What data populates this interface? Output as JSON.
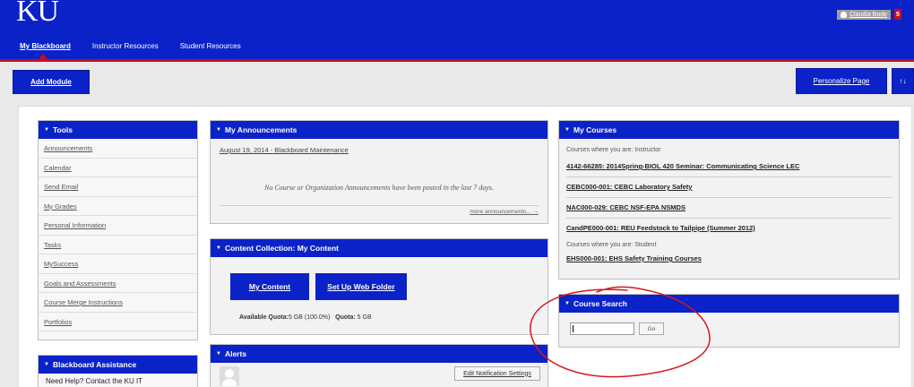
{
  "header": {
    "logo": "KU",
    "nav": [
      "My Blackboard",
      "Instructor Resources",
      "Student Resources"
    ],
    "user_name": "Claudia Bode",
    "user_badge": "5"
  },
  "toolbar": {
    "add_module": "Add Module",
    "personalize": "Personalize Page",
    "sort": "↑↓"
  },
  "tools": {
    "title": "Tools",
    "items": [
      "Announcements",
      "Calendar",
      "Send Email",
      "My Grades",
      "Personal Information",
      "Tasks",
      "MySuccess",
      "Goals and Assessments",
      "Course Merge Instructions",
      "Portfolios"
    ]
  },
  "assistance": {
    "title": "Blackboard Assistance",
    "text": "Need Help? Contact the KU IT"
  },
  "announcements": {
    "title": "My Announcements",
    "link": "August 19, 2014 - Blackboard Maintenance",
    "none_text": "No Course or Organization Announcements have been posted in the last 7 days.",
    "more": "more announcements... →"
  },
  "content_collection": {
    "title": "Content Collection: My Content",
    "btn_my_content": "My Content",
    "btn_web_folder": "Set Up Web Folder",
    "quota_label": "Available Quota:",
    "quota_value": "5 GB (100.0%)",
    "quota2_label": "Quota:",
    "quota2_value": "5 GB"
  },
  "alerts": {
    "title": "Alerts",
    "edit_button": "Edit Notification Settings"
  },
  "courses": {
    "title": "My Courses",
    "instructor_label": "Courses where you are: Instructor",
    "instructor_courses": [
      "4142-66285: 2014Spring-BIOL 420 Seminar: Communicating Science LEC",
      "CEBC000-001: CEBC Laboratory Safety",
      "NAC000-029: CEBC NSF-EPA NSMDS",
      "CandPE000-001: REU Feedstock to Tailpipe (Summer 2012)"
    ],
    "student_label": "Courses where you are: Student",
    "student_courses": [
      "EHS000-001: EHS Safety Training Courses"
    ]
  },
  "search": {
    "title": "Course Search",
    "go": "Go"
  },
  "colors": {
    "primary": "#0a22c8",
    "accent": "#c40d1e"
  }
}
